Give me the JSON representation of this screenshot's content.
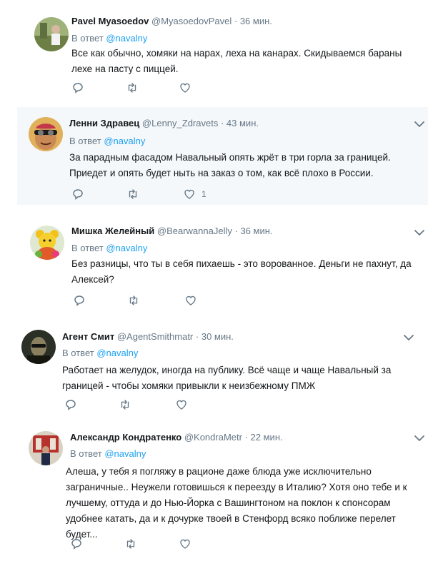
{
  "tweets": [
    {
      "name": "Pavel Myasoedov",
      "handle": "@MyasoedovPavel",
      "dot": "·",
      "time": "36 мин.",
      "reply_prefix": "В ответ",
      "reply_to": "@navalny",
      "text": "Все как обычно, хомяки на нарах, леха на канарах. Скидываемся бараны лехе на пасту с пиццей.",
      "likes": ""
    },
    {
      "name": "Ленни Здравец",
      "handle": "@Lenny_Zdravets",
      "dot": "·",
      "time": "43 мин.",
      "reply_prefix": "В ответ",
      "reply_to": "@navalny",
      "text": "За парадным фасадом Навальный опять жрёт в три горла за границей. Приедет и опять будет ныть на заказ о том, как всё плохо в России.",
      "likes": "1"
    },
    {
      "name": "Мишка Желейный",
      "handle": "@BearwannaJelly",
      "dot": "·",
      "time": "36 мин.",
      "reply_prefix": "В ответ",
      "reply_to": "@navalny",
      "text": "Без разницы, что ты в себя пихаешь - это ворованное. Деньги не пахнут, да Алексей?",
      "likes": ""
    },
    {
      "name": "Агент Смит",
      "handle": "@AgentSmithmatr",
      "dot": "·",
      "time": "30 мин.",
      "reply_prefix": "В ответ",
      "reply_to": "@navalny",
      "text": "Работает на желудок, иногда на публику. Всё чаще и чаще Навальный за границей - чтобы хомяки привыкли к неизбежному ПМЖ",
      "likes": ""
    },
    {
      "name": "Александр Кондратенко",
      "handle": "@KondraMetr",
      "dot": "·",
      "time": "22 мин.",
      "reply_prefix": "В ответ",
      "reply_to": "@navalny",
      "text": "Алеша, у тебя я погляжу в рационе даже блюда уже исключительно заграничные.. Неужели готовишься к переезду в Италию? Хотя оно тебе и к лучшему, оттуда и до Нью-Йорка с Вашингтоном на поклон к спонсорам удобнее катать, да и к дочурке твоей в Стенфорд всяко поближе перелет будет...",
      "likes": ""
    }
  ],
  "icons": {
    "reply": "reply-icon",
    "retweet": "retweet-icon",
    "like": "heart-icon",
    "menu": "chevron-down-icon"
  },
  "colors": {
    "link": "#1da1f2",
    "muted": "#657786",
    "text": "#14171a",
    "highlight_bg": "#f5f8fa"
  }
}
